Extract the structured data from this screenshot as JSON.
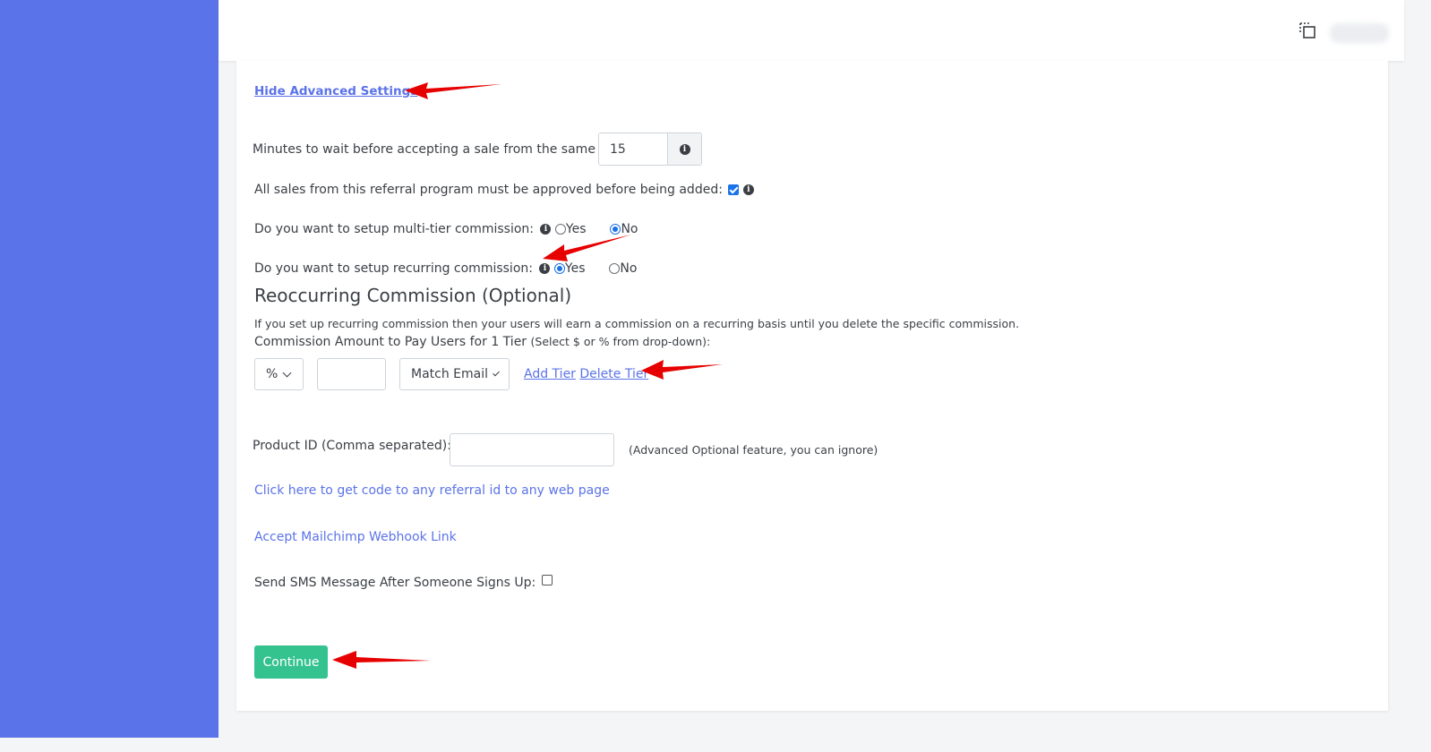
{
  "header": {
    "copy_icon": "copy-icon"
  },
  "form": {
    "hide_advanced_label": "Hide Advanced Settings",
    "wait_minutes_label": "Minutes to wait before accepting a sale from the same IP:",
    "wait_minutes_value": "15",
    "approve_sales_label": "All sales from this referral program must be approved before being added:",
    "approve_sales_checked": true,
    "multi_tier_label": "Do you want to setup multi-tier commission:",
    "multi_tier_yes": "Yes",
    "multi_tier_no": "No",
    "multi_tier_selected": "No",
    "recurring_label": "Do you want to setup recurring commission:",
    "recurring_yes": "Yes",
    "recurring_no": "No",
    "recurring_selected": "Yes",
    "recurring_heading": "Reoccurring Commission (Optional)",
    "recurring_desc": "If you set up recurring commission then your users will earn a commission on a recurring basis until you delete the specific commission.",
    "commission_amount_label": "Commission Amount to Pay Users for 1 Tier",
    "commission_amount_hint": "(Select $ or % from drop-down):",
    "commission_type_value": "%",
    "commission_value": "",
    "match_select_value": "Match Email",
    "add_tier": "Add Tier",
    "delete_tier": "Delete Tier",
    "product_id_label": "Product ID (Comma separated):",
    "product_id_value": "",
    "product_id_hint": "(Advanced Optional feature, you can ignore)",
    "referral_code_link": "Click here to get code to any referral id to any web page",
    "mailchimp_link": "Accept Mailchimp Webhook Link",
    "sms_label": "Send SMS Message After Someone Signs Up:",
    "sms_checked": false,
    "continue_label": "Continue"
  },
  "colors": {
    "sidebar": "#5b73e8",
    "link": "#5b73e8",
    "continue_button": "#34c38f",
    "annotation_arrow": "#e60000"
  }
}
